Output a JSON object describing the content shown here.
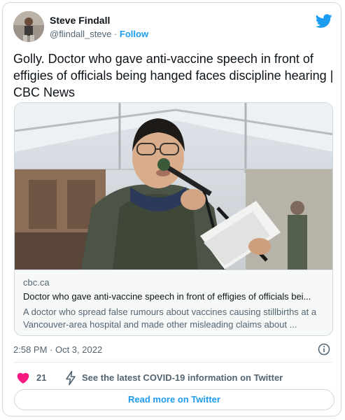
{
  "author": {
    "name": "Steve Findall",
    "handle": "@flindall_steve",
    "separator": " · ",
    "follow_label": "Follow"
  },
  "tweet": {
    "text": "Golly. Doctor who gave anti-vaccine speech in front of effigies of officials being hanged faces discipline hearing | CBC News",
    "timestamp": "2:58 PM · Oct 3, 2022"
  },
  "link_card": {
    "domain": "cbc.ca",
    "title": "Doctor who gave anti-vaccine speech in front of effigies of officials bei...",
    "description": "A doctor who spread false rumours about vaccines causing stillbirths at a Vancouver-area hospital and made other misleading claims about ..."
  },
  "actions": {
    "like_count": "21",
    "covid_info": "See the latest COVID-19 information on Twitter"
  },
  "read_more_label": "Read more on Twitter",
  "icons": {
    "brand": "twitter-bird-icon",
    "info": "info-icon",
    "like": "heart-icon",
    "covid": "lightning-bolt-icon"
  },
  "colors": {
    "brand_blue": "#1d9bf0",
    "like_red": "#f91880",
    "text": "#0f1419",
    "secondary": "#536471",
    "border": "#cfd9de"
  }
}
